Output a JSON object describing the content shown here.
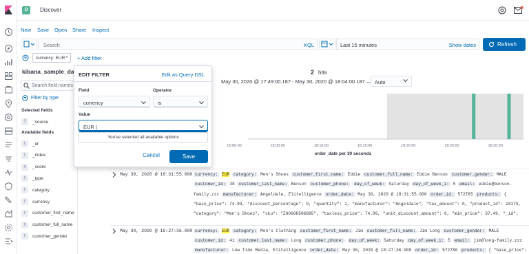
{
  "app": {
    "space_initial": "D",
    "title": "Discover"
  },
  "top_menu": {
    "new": "New",
    "save": "Save",
    "open": "Open",
    "share": "Share",
    "inspect": "Inspect"
  },
  "query": {
    "placeholder": "Search",
    "language": "KQL",
    "time_range": "Last 15 minutes",
    "show_dates": "Show dates",
    "refresh": "Refresh"
  },
  "filter_bar": {
    "pill": "currency: EUR",
    "add_filter": "+ Add filter"
  },
  "sidebar": {
    "index_pattern": "kibana_sample_data",
    "search_placeholder": "Search field names",
    "filter_by_type": "Filter by type",
    "selected_fields_title": "Selected fields",
    "selected_fields": [
      {
        "type": "?",
        "name": "_source"
      }
    ],
    "available_fields_title": "Available fields",
    "available_fields": [
      {
        "type": "t",
        "name": "_id"
      },
      {
        "type": "t",
        "name": "_index"
      },
      {
        "type": "#",
        "name": "_score"
      },
      {
        "type": "t",
        "name": "_type"
      },
      {
        "type": "t",
        "name": "category"
      },
      {
        "type": "t",
        "name": "currency"
      },
      {
        "type": "t",
        "name": "customer_first_name"
      },
      {
        "type": "t",
        "name": "customer_full_name"
      },
      {
        "type": "t",
        "name": "customer_gender"
      }
    ]
  },
  "edit_filter": {
    "title": "EDIT FILTER",
    "edit_as_query": "Edit as Query DSL",
    "field_label": "Field",
    "field_value": "currency",
    "operator_label": "Operator",
    "operator_value": "is",
    "value_label": "Value",
    "value_input": "EUR",
    "dropdown_message": "You've selected all available options",
    "cancel": "Cancel",
    "save": "Save"
  },
  "hits": {
    "count": "2",
    "label": "hits",
    "date_range": "May 30, 2020 @ 17:49:00.187 - May 30, 2020 @ 18:04:00.187 —",
    "interval": "Auto"
  },
  "chart_data": {
    "type": "bar",
    "xlabel": "order_date per 30 seconds",
    "x_ticks": [
      "16:00:00",
      "18:05:00",
      "18:10:00",
      "18:15:00",
      "18:20:00",
      "18:25:00",
      "18:30:00"
    ],
    "bars": [
      {
        "time": "18:27:36",
        "count": 1
      },
      {
        "time": "18:31:55",
        "count": 1
      }
    ],
    "series_color": "#54b399",
    "shaded_color": "#e3e3e3"
  },
  "documents": [
    {
      "time": "May 30, 2020 @ 18:31:55.000",
      "lines": [
        [
          [
            "l",
            "currency:"
          ],
          [
            "h",
            "EUR"
          ],
          [
            "l",
            "category:"
          ],
          [
            "v",
            "Men's Shoes"
          ],
          [
            "l",
            "customer_first_name:"
          ],
          [
            "v",
            "Eddie"
          ],
          [
            "l",
            "customer_full_name:"
          ],
          [
            "v",
            "Eddie Benson"
          ],
          [
            "l",
            "customer_gender:"
          ],
          [
            "v",
            "MALE"
          ]
        ],
        [
          [
            "l",
            "customer_id:"
          ],
          [
            "v",
            "38"
          ],
          [
            "l",
            "customer_last_name:"
          ],
          [
            "v",
            "Benson"
          ],
          [
            "l",
            "customer_phone:"
          ],
          [
            "v",
            " "
          ],
          [
            "l",
            "day_of_week:"
          ],
          [
            "v",
            "Saturday"
          ],
          [
            "l",
            "day_of_week_i:"
          ],
          [
            "v",
            "5"
          ],
          [
            "l",
            "email:"
          ],
          [
            "v",
            "eddie@benson-"
          ]
        ],
        [
          [
            "v",
            "family.zzz"
          ],
          [
            "l",
            "manufacturer:"
          ],
          [
            "v",
            "Angeldale, Elitelligence"
          ],
          [
            "l",
            "order_date:"
          ],
          [
            "v",
            "May 30, 2020 @ 18:31:55.000"
          ],
          [
            "l",
            "order_id:"
          ],
          [
            "v",
            "572785"
          ],
          [
            "l",
            "products:"
          ],
          [
            "v",
            "{"
          ]
        ],
        [
          [
            "v",
            "\"base_price\": 74.99, \"discount_percentage\": 0, \"quantity\": 1, \"manufacturer\": \"Angeldale\", \"tax_amount\": 0, \"product_id\": 18175,"
          ]
        ],
        [
          [
            "v",
            "\"category\": \"Men's Shoes\", \"sku\": \"ZO0688506885\", \"taxless_price\": 74.99, \"unit_discount_amount\": 0, \"min_price\": 37.49, \"_id\":"
          ]
        ]
      ]
    },
    {
      "time": "May 30, 2020 @ 18:27:36.000",
      "lines": [
        [
          [
            "l",
            "currency:"
          ],
          [
            "h",
            "EUR"
          ],
          [
            "l",
            "category:"
          ],
          [
            "v",
            "Men's Clothing"
          ],
          [
            "l",
            "customer_first_name:"
          ],
          [
            "v",
            "Jim"
          ],
          [
            "l",
            "customer_full_name:"
          ],
          [
            "v",
            "Jim Long"
          ],
          [
            "l",
            "customer_gender:"
          ],
          [
            "v",
            "MALE"
          ]
        ],
        [
          [
            "l",
            "customer_id:"
          ],
          [
            "v",
            "41"
          ],
          [
            "l",
            "customer_last_name:"
          ],
          [
            "v",
            "Long"
          ],
          [
            "l",
            "customer_phone:"
          ],
          [
            "v",
            " "
          ],
          [
            "l",
            "day_of_week:"
          ],
          [
            "v",
            "Saturday"
          ],
          [
            "l",
            "day_of_week_i:"
          ],
          [
            "v",
            "5"
          ],
          [
            "l",
            "email:"
          ],
          [
            "v",
            "jim@long-family.zzz"
          ]
        ],
        [
          [
            "l",
            "manufacturer:"
          ],
          [
            "v",
            "Low Tide Media, Elitelligence"
          ],
          [
            "l",
            "order_date:"
          ],
          [
            "v",
            "May 30, 2020 @ 18:27:36.000"
          ],
          [
            "l",
            "order_id:"
          ],
          [
            "v",
            "572780"
          ],
          [
            "l",
            "products:"
          ],
          [
            "v",
            "{ \"base_price\":"
          ]
        ]
      ]
    }
  ],
  "colors": {
    "link": "#006bb4",
    "primary_button": "#006bb4",
    "highlight": "#fff03f"
  }
}
